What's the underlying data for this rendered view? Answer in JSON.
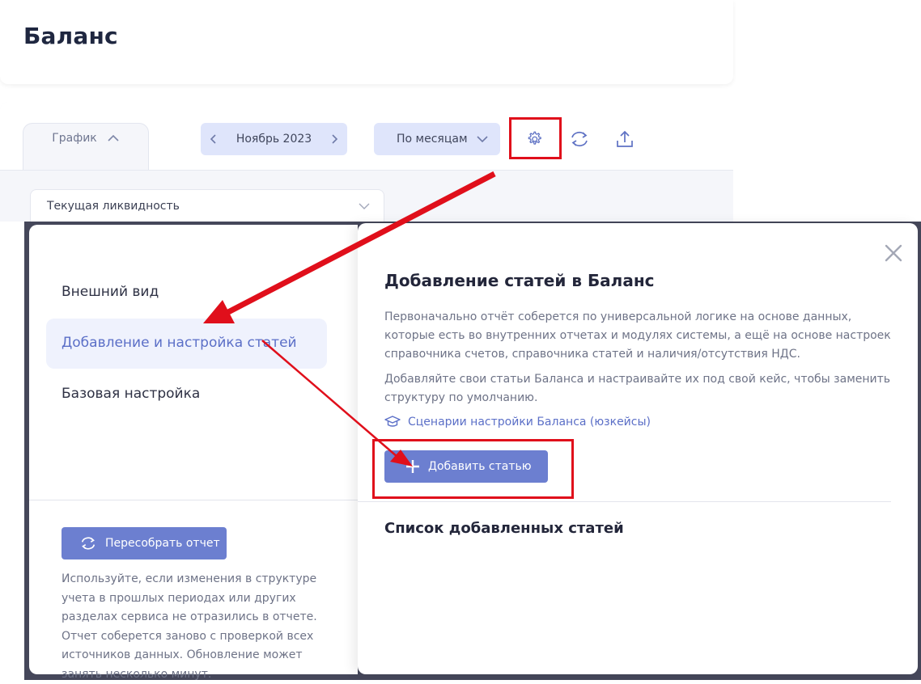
{
  "page": {
    "title": "Баланс"
  },
  "toolbar": {
    "tab_label": "График",
    "period_label": "Ноябрь 2023",
    "grouping_label": "По месяцам",
    "metric_label": "Текущая ликвидность"
  },
  "sidebar": {
    "items": [
      {
        "label": "Внешний вид"
      },
      {
        "label": "Добавление и настройка статей"
      },
      {
        "label": "Базовая настройка"
      }
    ],
    "rebuild_label": "Пересобрать отчет",
    "rebuild_hint": "Используйте, если изменения в структуре учета в прошлых периодах или других разделах сервиса не отразились в отчете. Отчет соберется заново с проверкой всех источников данных. Обновление может занять несколько минут."
  },
  "main": {
    "title": "Добавление статей в Баланс",
    "description_1": "Первоначально отчёт соберется по универсальной логике на основе данных, которые есть во внутренних отчетах и модулях системы, а ещё на основе настроек справочника счетов, справочника статей и наличия/отсутствия НДС.",
    "description_2": "Добавляйте свои статьи Баланса и настраивайте их под свой кейс, чтобы заменить структуру по умолчанию.",
    "scenario_link": "Сценарии настройки Баланса (юзкейсы)",
    "add_button": "Добавить статью",
    "list_title": "Список добавленных статей"
  },
  "colors": {
    "accent": "#6c7fd0",
    "link": "#5b6fc7",
    "pill": "#dfe5fb",
    "annotation": "#e00f1b"
  }
}
